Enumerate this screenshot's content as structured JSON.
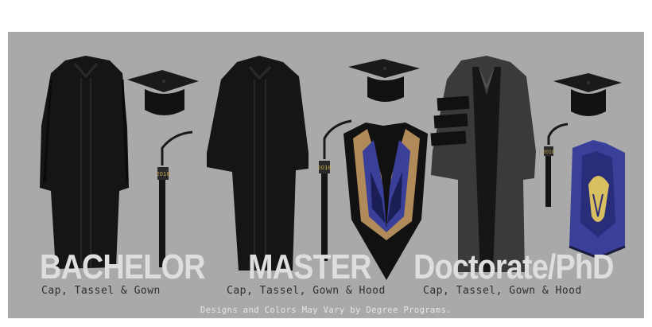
{
  "degrees": [
    {
      "title": "BACHELOR",
      "items": "Cap, Tassel & Gown"
    },
    {
      "title": "MASTER",
      "items": "Cap, Tassel, Gown & Hood"
    },
    {
      "title": "Doctorate/PhD",
      "items": "Cap, Tassel, Gown & Hood"
    }
  ],
  "tassel_charm_year": "2018",
  "footer_note": "Designs and Colors May Vary by Degree Programs.",
  "colors": {
    "background": "#a9a9a9",
    "gown": "#151515",
    "doctoral_gown": "#3a3a3a",
    "hood_tan": "#b08a58",
    "hood_blue": "#3a3f9a",
    "hood_gold": "#d8c060",
    "title_text": "#dedede"
  }
}
